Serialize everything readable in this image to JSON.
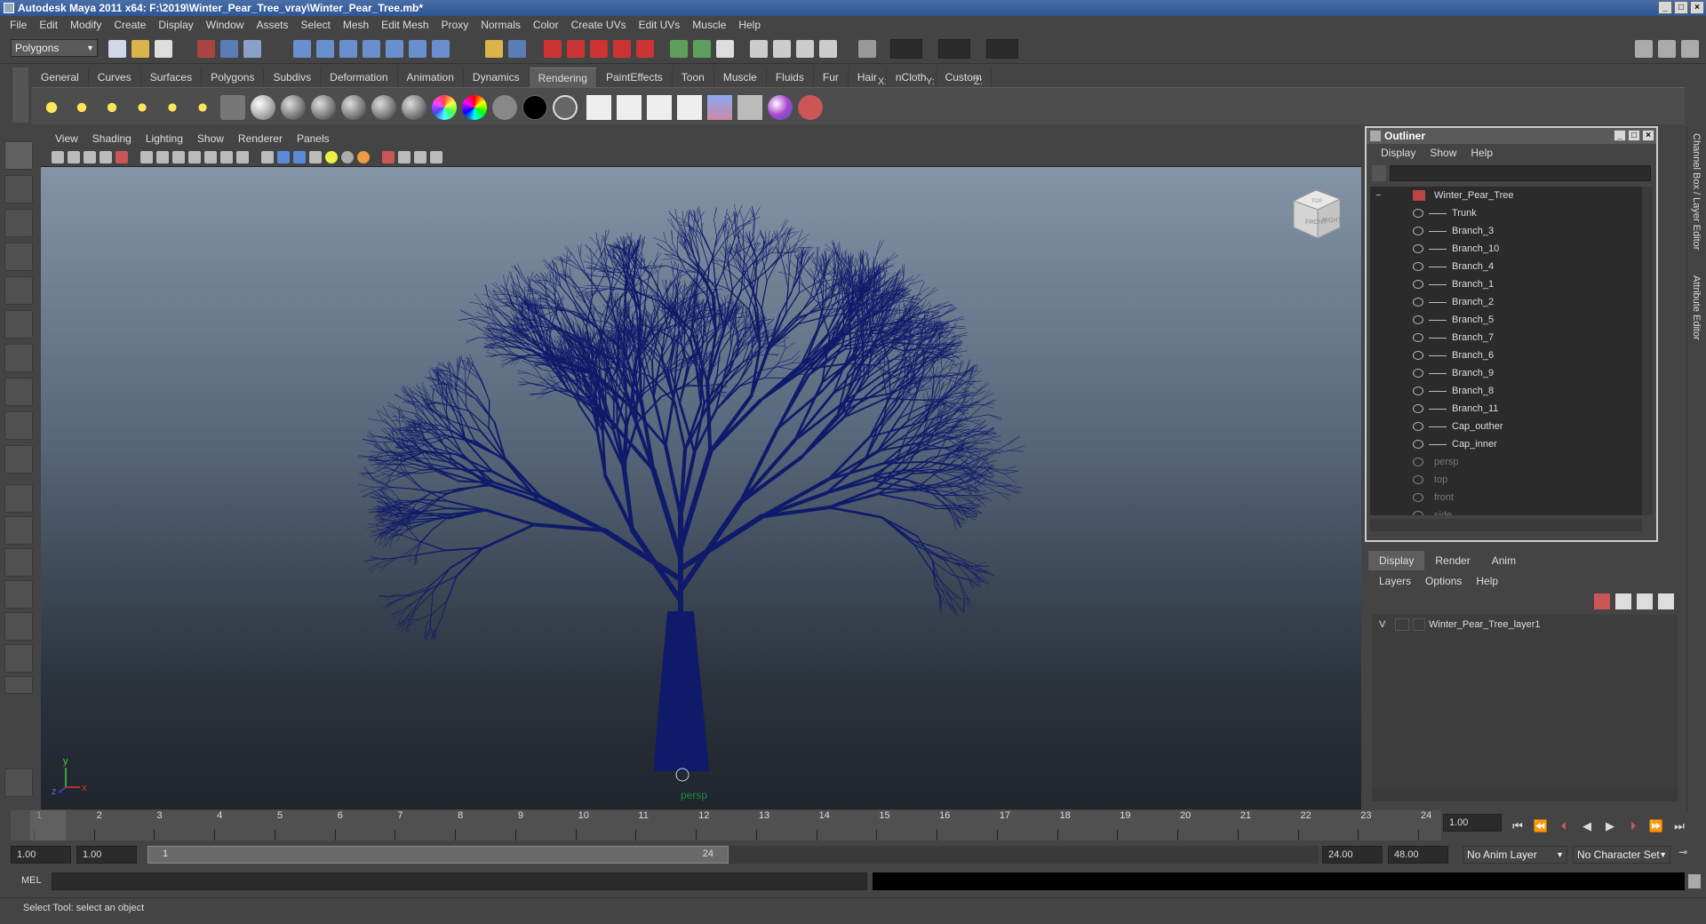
{
  "window": {
    "title": "Autodesk Maya 2011 x64: F:\\2019\\Winter_Pear_Tree_vray\\Winter_Pear_Tree.mb*"
  },
  "menubar": [
    "File",
    "Edit",
    "Modify",
    "Create",
    "Display",
    "Window",
    "Assets",
    "Select",
    "Mesh",
    "Edit Mesh",
    "Proxy",
    "Normals",
    "Color",
    "Create UVs",
    "Edit UVs",
    "Muscle",
    "Help"
  ],
  "statusline": {
    "mode": "Polygons",
    "x_label": "X:",
    "y_label": "Y:",
    "z_label": "Z:"
  },
  "shelf_tabs": [
    "General",
    "Curves",
    "Surfaces",
    "Polygons",
    "Subdivs",
    "Deformation",
    "Animation",
    "Dynamics",
    "Rendering",
    "PaintEffects",
    "Toon",
    "Muscle",
    "Fluids",
    "Fur",
    "Hair",
    "nCloth",
    "Custom"
  ],
  "active_shelf": "Rendering",
  "viewport": {
    "menu": [
      "View",
      "Shading",
      "Lighting",
      "Show",
      "Renderer",
      "Panels"
    ],
    "camera_label": "persp",
    "viewcube": {
      "front": "FRONT",
      "right": "RIGHT",
      "top": "TOP"
    },
    "axis": {
      "x": "x",
      "y": "y",
      "z": "z"
    },
    "tree_color": "#0f1a6a"
  },
  "outliner": {
    "title": "Outliner",
    "menu": [
      "Display",
      "Show",
      "Help"
    ],
    "collapse": "−",
    "root": "Winter_Pear_Tree",
    "children": [
      "Trunk",
      "Branch_3",
      "Branch_10",
      "Branch_4",
      "Branch_1",
      "Branch_2",
      "Branch_5",
      "Branch_7",
      "Branch_6",
      "Branch_9",
      "Branch_8",
      "Branch_11",
      "Cap_outher",
      "Cap_inner"
    ],
    "cameras": [
      "persp",
      "top",
      "front",
      "side"
    ]
  },
  "layer_editor": {
    "tabs": [
      "Display",
      "Render",
      "Anim"
    ],
    "active_tab": "Display",
    "menu": [
      "Layers",
      "Options",
      "Help"
    ],
    "layers": [
      {
        "visible": "V",
        "name": "Winter_Pear_Tree_layer1"
      }
    ]
  },
  "right_strip": {
    "channel_box": "Channel Box / Layer Editor",
    "attribute_editor": "Attribute Editor"
  },
  "timeline": {
    "ticks": [
      1,
      2,
      3,
      4,
      5,
      6,
      7,
      8,
      9,
      10,
      11,
      12,
      13,
      14,
      15,
      16,
      17,
      18,
      19,
      20,
      21,
      22,
      23,
      24
    ],
    "current_frame": "1.00"
  },
  "range": {
    "start": "1.00",
    "playback_start": "1.00",
    "slider_start": "1",
    "slider_end": "24",
    "playback_end": "24.00",
    "end": "48.00",
    "anim_layer": "No Anim Layer",
    "character_set": "No Character Set"
  },
  "mel": {
    "label": "MEL"
  },
  "help_line": "Select Tool: select an object"
}
